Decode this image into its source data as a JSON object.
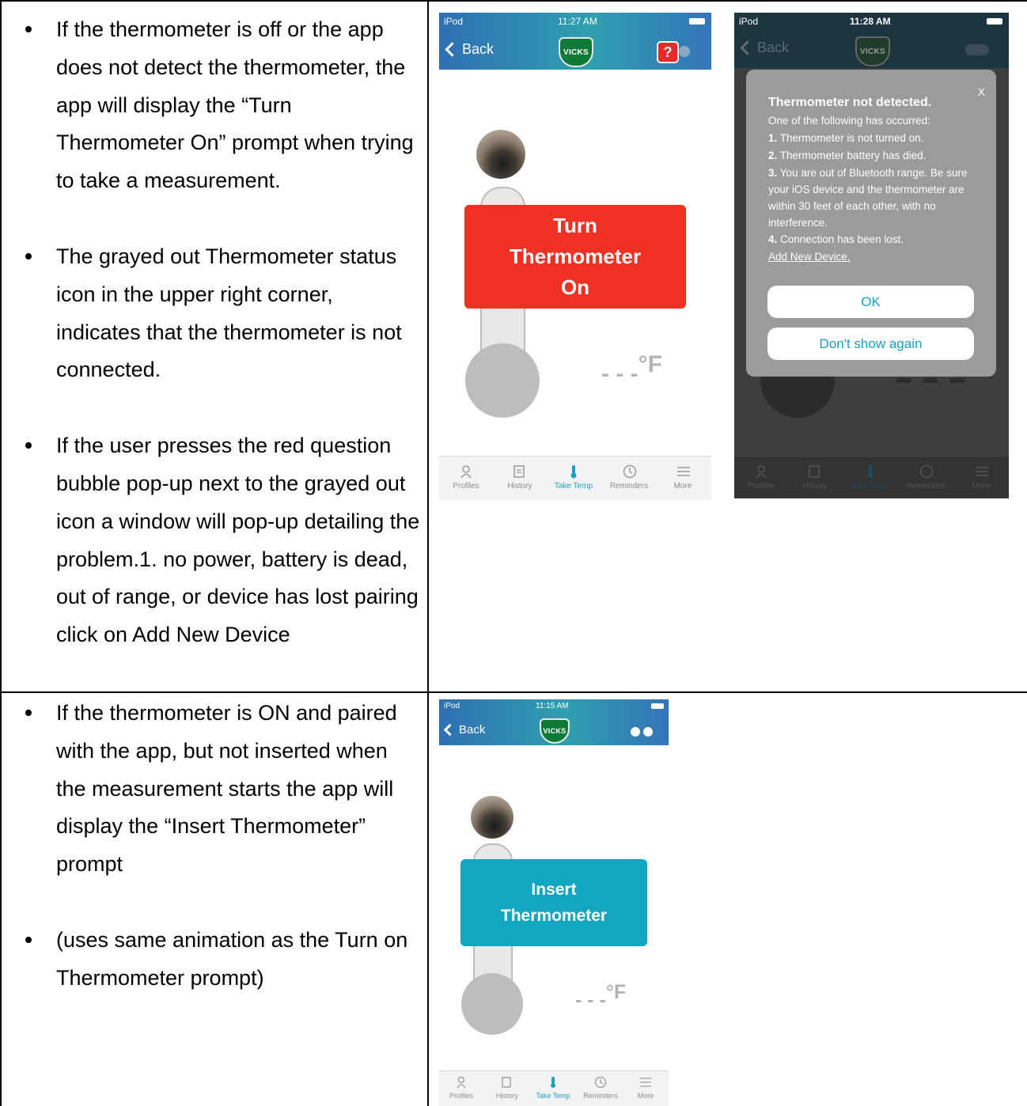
{
  "row1": {
    "bullets": [
      "If the thermometer is off or the app does not detect the thermometer, the app will display the “Turn Thermometer On” prompt when trying to take a measurement.",
      "The grayed out Thermometer status icon in the upper right corner, indicates that the thermometer is not connected.",
      "If the user presses the red question bubble pop-up next to the grayed out icon a window will pop-up detailing the problem.1. no power, battery is dead, out of range, or device has lost pairing click on Add New Device"
    ]
  },
  "row2": {
    "bullets": [
      "If the thermometer is ON and paired with the app, but not inserted when the measurement starts the app will display the “Insert Thermometer” prompt",
      "(uses same animation as the Turn on Thermometer prompt)"
    ]
  },
  "phone1": {
    "carrier": "iPod",
    "time": "11:27 AM",
    "back_label": "Back",
    "logo": "VICKS",
    "help_mark": "?",
    "prompt_lines": [
      "Turn",
      "Thermometer",
      "On"
    ],
    "temp_dashes": "- - -",
    "temp_unit": "°F",
    "prompt_color": "#ef3123"
  },
  "phone2": {
    "carrier": "iPod",
    "time": "11:28 AM",
    "back_label": "Back",
    "logo": "VICKS",
    "dialog": {
      "close": "X",
      "title": "Thermometer not detected.",
      "intro": "One of the following has occurred:",
      "items": [
        {
          "num": "1.",
          "text": "Thermometer is not turned on."
        },
        {
          "num": "2.",
          "text": "Thermometer battery has died."
        },
        {
          "num": "3.",
          "text": "You are out of Bluetooth range.  Be sure your iOS device and the thermometer are within 30 feet of each other, with no interference."
        },
        {
          "num": "4.",
          "text": "Connection has been lost."
        }
      ],
      "link": "Add New Device.",
      "ok_label": "OK",
      "dont_show_label": "Don't show again"
    }
  },
  "phone3": {
    "carrier": "iPod",
    "time": "11:15 AM",
    "back_label": "Back",
    "logo": "VICKS",
    "prompt_lines": [
      "Insert",
      "Thermometer"
    ],
    "temp_dashes": "- - -",
    "temp_unit": "°F",
    "prompt_color": "#13a6c1"
  },
  "tabs": [
    "Profiles",
    "History",
    "Take Temp",
    "Reminders",
    "More"
  ],
  "colors": {
    "accent": "#1aa0c4",
    "nav_blue": "#2f6fb3"
  }
}
